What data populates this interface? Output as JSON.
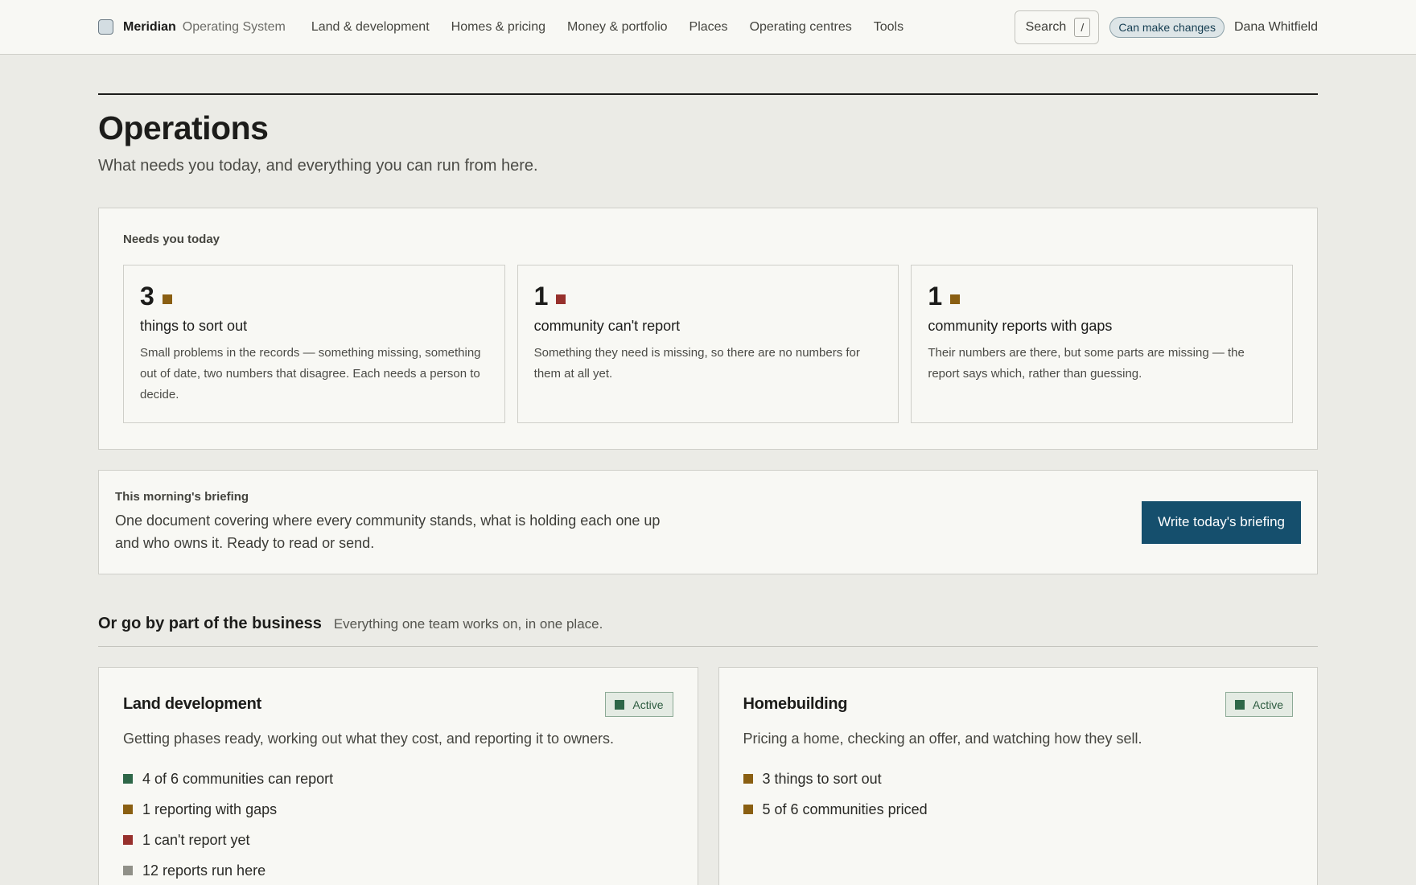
{
  "colors": {
    "amber": "#8a5f12",
    "red": "#97302c",
    "green": "#2e6748",
    "grey": "#909088",
    "primary": "#154f6d"
  },
  "topbar": {
    "brand": "Meridian",
    "brand_sub": "Operating System",
    "nav": [
      "Land & development",
      "Homes & pricing",
      "Money & portfolio",
      "Places",
      "Operating centres",
      "Tools"
    ],
    "search_label": "Search",
    "search_shortcut": "/",
    "permission_badge": "Can make changes",
    "user_name": "Dana Whitfield"
  },
  "page": {
    "title": "Operations",
    "subtitle": "What needs you today, and everything you can run from here."
  },
  "needs_today": {
    "label": "Needs you today",
    "cards": [
      {
        "count": "3",
        "status": "amber",
        "title": "things to sort out",
        "desc": "Small problems in the records — something missing, something out of date, two numbers that disagree. Each needs a person to decide."
      },
      {
        "count": "1",
        "status": "red",
        "title": "community can't report",
        "desc": "Something they need is missing, so there are no numbers for them at all yet."
      },
      {
        "count": "1",
        "status": "amber",
        "title": "community reports with gaps",
        "desc": "Their numbers are there, but some parts are missing — the report says which, rather than guessing."
      }
    ]
  },
  "briefing": {
    "label": "This morning's briefing",
    "desc": "One document covering where every community stands, what is holding each one up and who owns it. Ready to read or send.",
    "button": "Write today's briefing"
  },
  "business": {
    "title": "Or go by part of the business",
    "subtitle": "Everything one team works on, in one place.",
    "areas": [
      {
        "title": "Land development",
        "badge": "Active",
        "desc": "Getting phases ready, working out what they cost, and reporting it to owners.",
        "stats": [
          {
            "status": "green",
            "text": "4 of 6 communities can report"
          },
          {
            "status": "amber",
            "text": "1 reporting with gaps"
          },
          {
            "status": "red",
            "text": "1 can't report yet"
          },
          {
            "status": "grey",
            "text": "12 reports run here"
          }
        ]
      },
      {
        "title": "Homebuilding",
        "badge": "Active",
        "desc": "Pricing a home, checking an offer, and watching how they sell.",
        "stats": [
          {
            "status": "amber",
            "text": "3 things to sort out"
          },
          {
            "status": "amber",
            "text": "5 of 6 communities priced"
          }
        ]
      }
    ]
  }
}
